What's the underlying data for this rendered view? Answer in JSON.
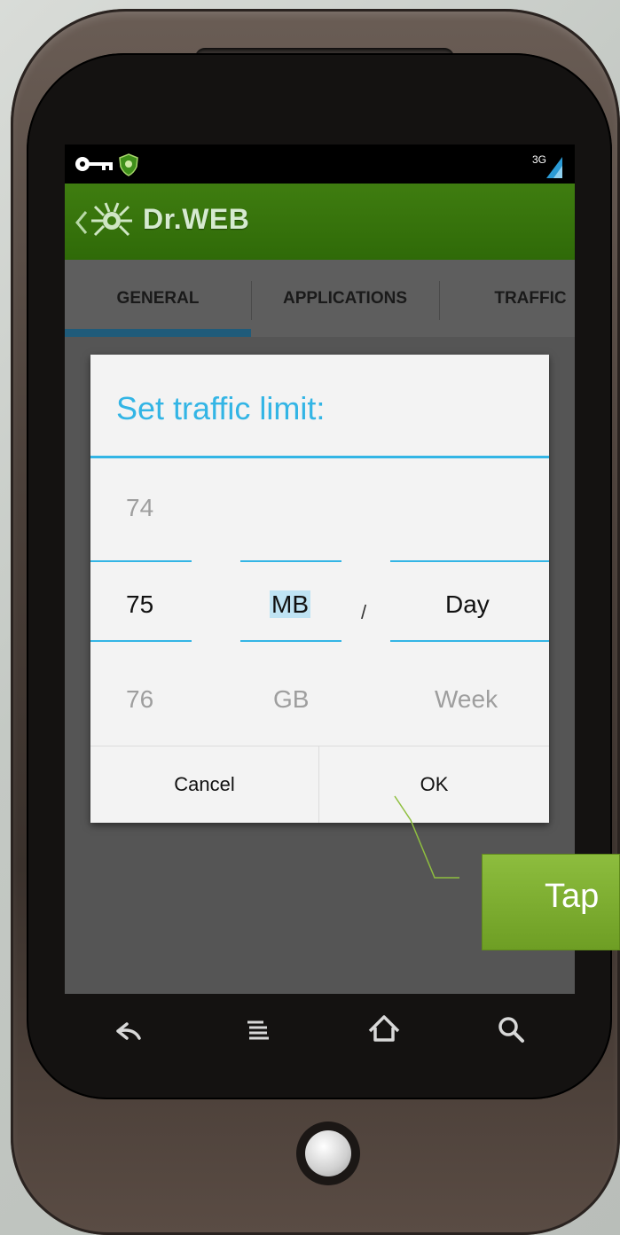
{
  "app": {
    "title": "Dr.WEB"
  },
  "tabs": [
    {
      "label": "GENERAL",
      "active": true
    },
    {
      "label": "APPLICATIONS",
      "active": false
    },
    {
      "label": "TRAFFIC",
      "active": false
    }
  ],
  "status_bar": {
    "network": "3G"
  },
  "dialog": {
    "title": "Set traffic limit:",
    "picker": {
      "number": {
        "prev": "74",
        "current": "75",
        "next": "76"
      },
      "unit": {
        "current": "MB",
        "next": "GB"
      },
      "separator": "/",
      "period": {
        "current": "Day",
        "next": "Week"
      }
    },
    "cancel_label": "Cancel",
    "ok_label": "OK"
  },
  "callout": {
    "text": "Tap"
  },
  "nav": {
    "icons": [
      "back-icon",
      "menu-icon",
      "home-icon",
      "search-icon"
    ]
  },
  "colors": {
    "accent": "#33b5e5",
    "app_bar": "#3a7a0f",
    "tab_indicator": "#1f5b7a",
    "callout": "#7aab2c"
  }
}
